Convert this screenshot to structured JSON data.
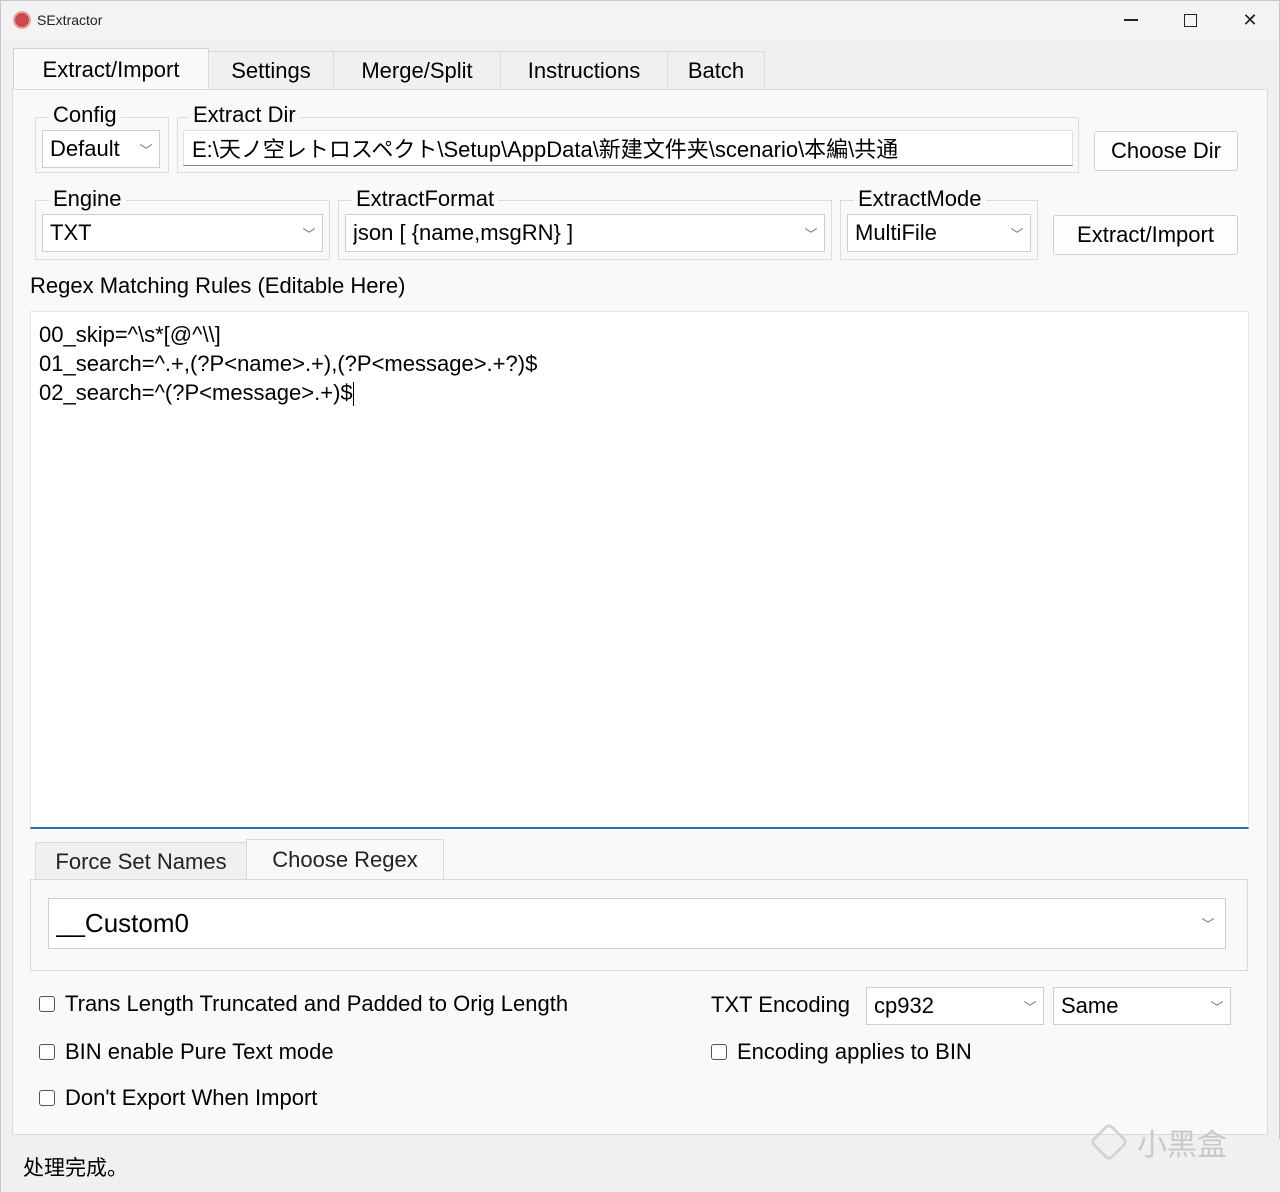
{
  "window": {
    "title": "SExtractor"
  },
  "tabs": [
    {
      "label": "Extract/Import",
      "active": true
    },
    {
      "label": "Settings"
    },
    {
      "label": "Merge/Split"
    },
    {
      "label": "Instructions"
    },
    {
      "label": "Batch"
    }
  ],
  "config": {
    "label": "Config",
    "value": "Default"
  },
  "extract_dir": {
    "label": "Extract Dir",
    "value": "E:\\天ノ空レトロスペクト\\Setup\\AppData\\新建文件夹\\scenario\\本編\\共通",
    "choose_button": "Choose Dir"
  },
  "engine": {
    "label": "Engine",
    "value": "TXT"
  },
  "extract_format": {
    "label": "ExtractFormat",
    "value": "json [ {name,msgRN} ]"
  },
  "extract_mode": {
    "label": "ExtractMode",
    "value": "MultiFile"
  },
  "extract_button": "Extract/Import",
  "regex": {
    "label": "Regex Matching Rules (Editable Here)",
    "lines": [
      "00_skip=^\\s*[@^\\\\]",
      "01_search=^.+,(?P<name>.+),(?P<message>.+?)$",
      "02_search=^(?P<message>.+)$"
    ]
  },
  "subtabs": [
    {
      "label": "Force Set Names"
    },
    {
      "label": "Choose Regex",
      "active": true
    }
  ],
  "choose_regex": {
    "value": "__Custom0"
  },
  "options": {
    "trans_length": {
      "label": "Trans Length Truncated and Padded to Orig Length",
      "checked": false
    },
    "bin_pure_text": {
      "label": "BIN enable Pure Text mode",
      "checked": false
    },
    "dont_export": {
      "label": "Don't Export When Import",
      "checked": false
    },
    "encoding_bin": {
      "label": "Encoding applies to BIN",
      "checked": false
    }
  },
  "txt_encoding": {
    "label": "TXT Encoding",
    "value": "cp932",
    "second_value": "Same"
  },
  "status": {
    "text": "处理完成。"
  },
  "watermark": {
    "text": "小黑盒"
  }
}
